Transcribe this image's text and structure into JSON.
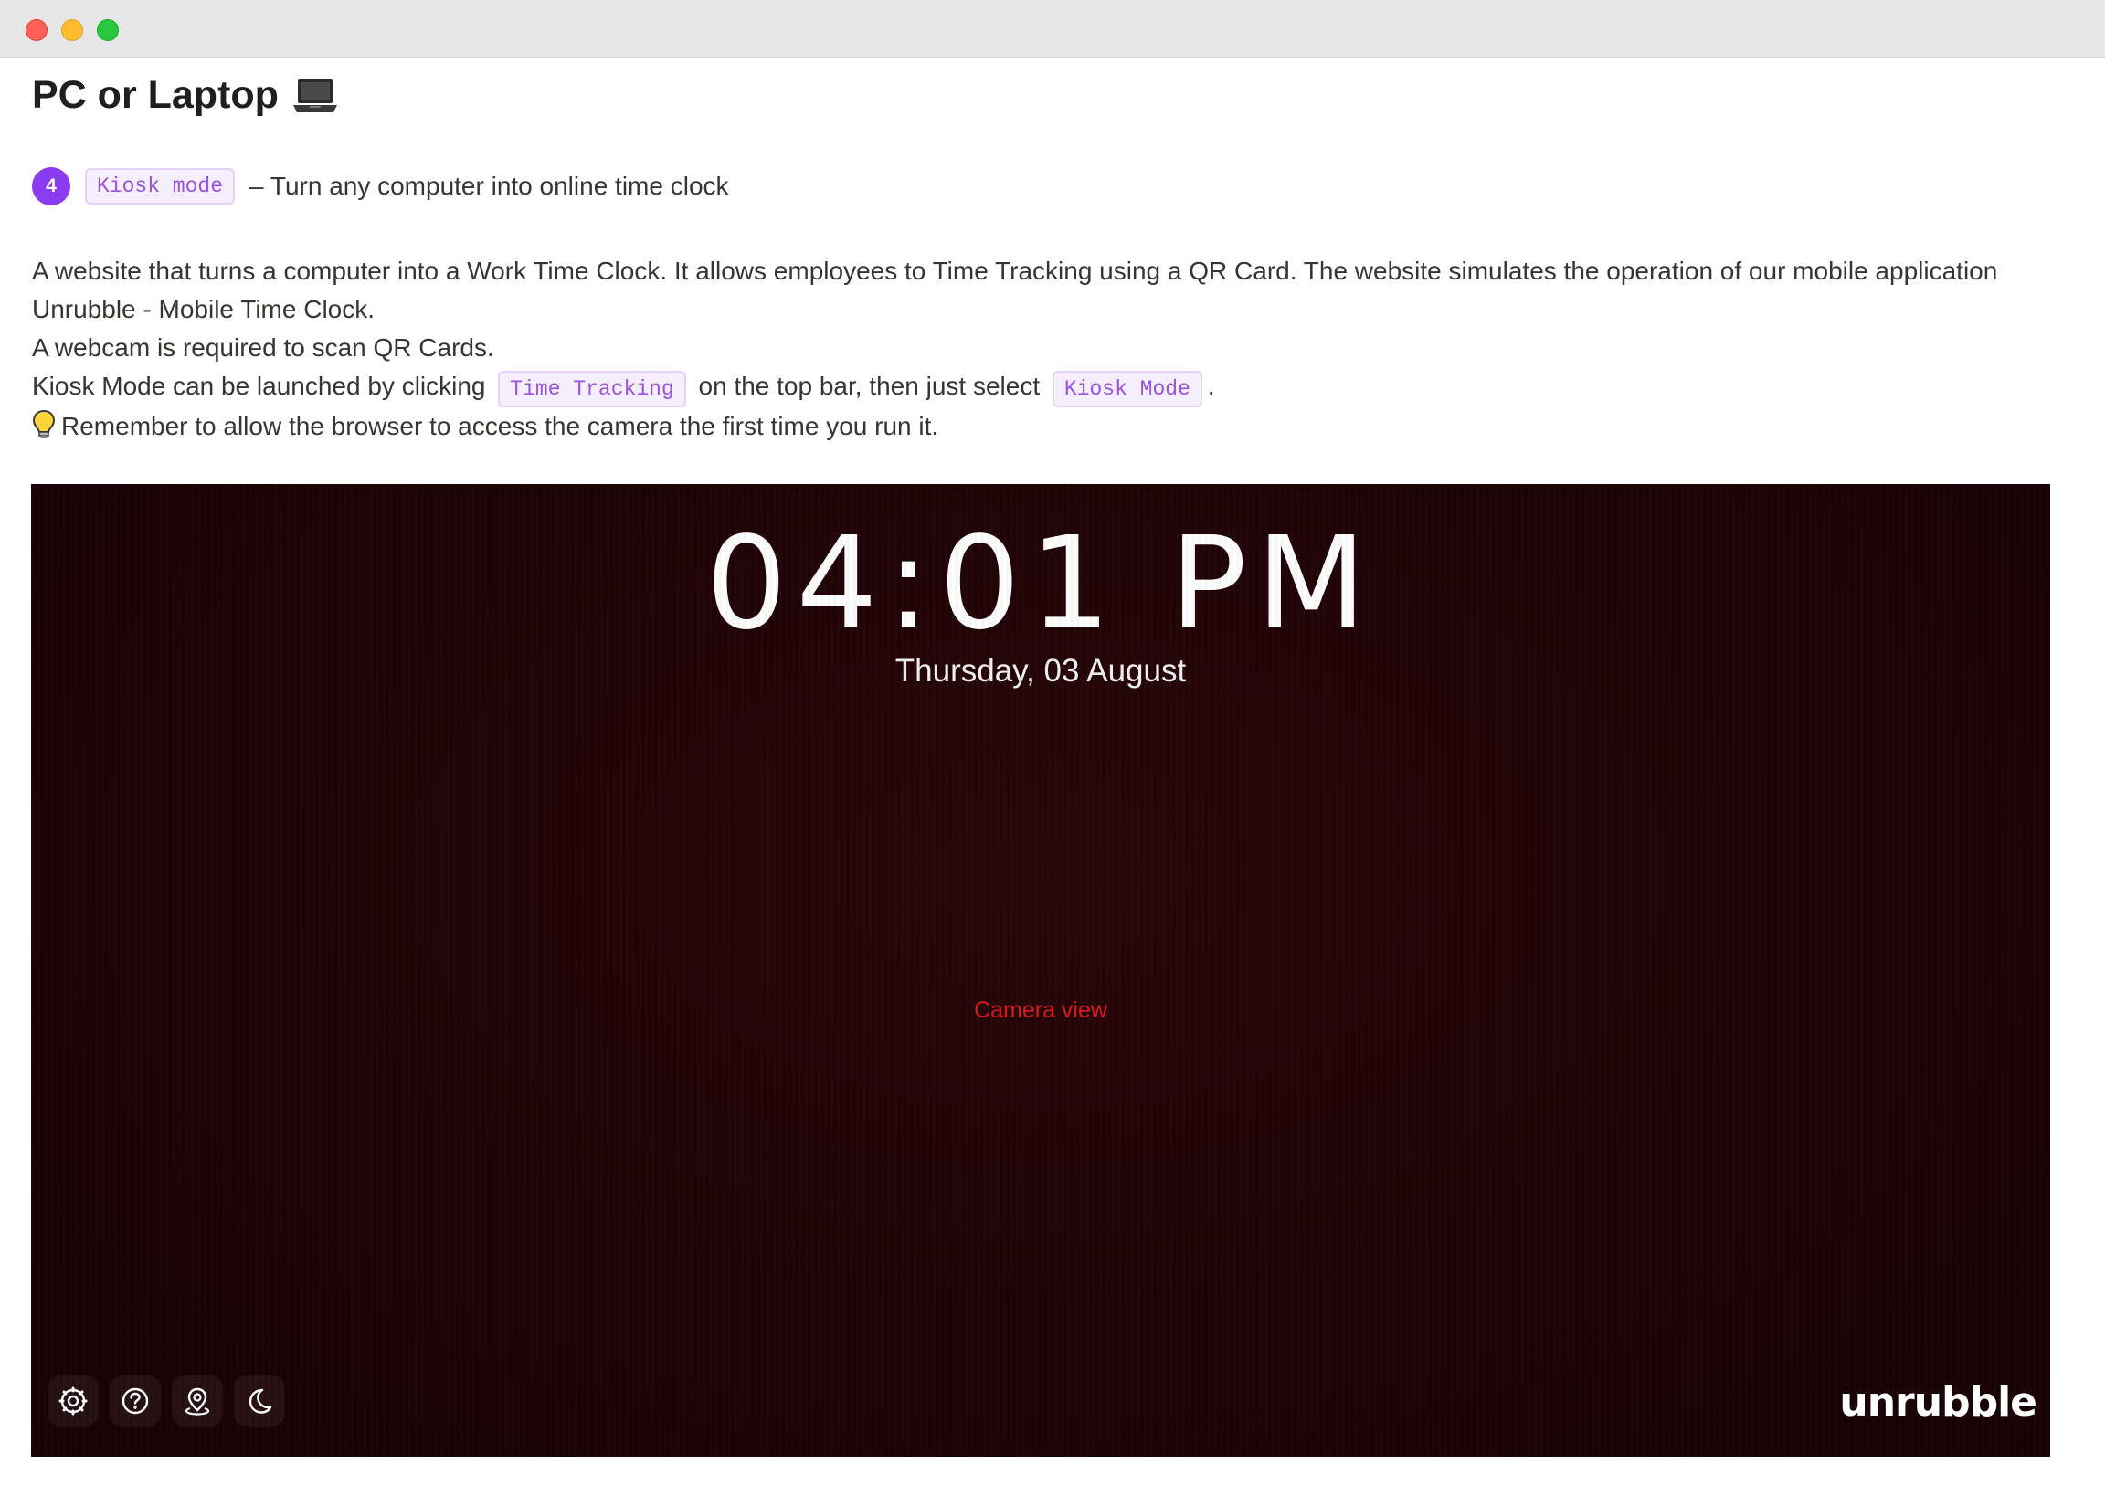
{
  "header": {
    "title": "PC or Laptop",
    "title_icon": "laptop-icon"
  },
  "step": {
    "number": "4",
    "chip": "Kiosk mode",
    "text": "– Turn any computer into online time clock",
    "badge_color": "#8b3cf0"
  },
  "description": {
    "line1": "A website that turns a computer into a Work Time Clock. It allows employees to Time Tracking using a QR Card. The website simulates the operation of our mobile application",
    "line2": "Unrubble - Mobile Time Clock.",
    "line3": "A webcam is required to scan QR Cards.",
    "line4_prefix": "Kiosk Mode can be launched by clicking",
    "line4_chip1": "Time Tracking",
    "line4_middle": "on the top bar, then just select",
    "line4_chip2": "Kiosk Mode",
    "line4_suffix": ".",
    "tip_icon": "lightbulb-icon",
    "tip": "Remember to allow the browser to access the camera the first time you run it."
  },
  "kiosk": {
    "time": "04:01 PM",
    "date": "Thursday, 03 August",
    "camera_label": "Camera view",
    "brand": "unrubble",
    "tools": [
      "settings-icon",
      "help-icon",
      "location-icon",
      "dark-mode-icon"
    ],
    "background_color": "#1e0306",
    "camera_label_color": "#d41a1a"
  }
}
